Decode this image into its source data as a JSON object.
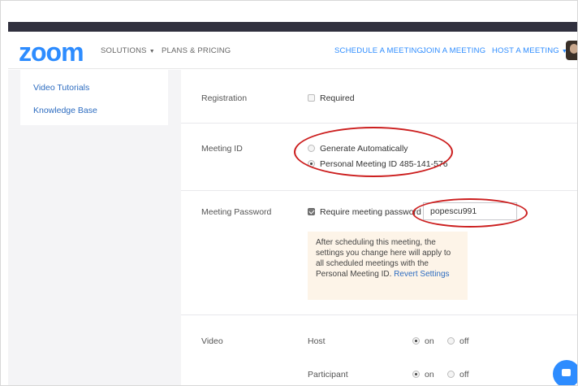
{
  "brand": {
    "logo": "zoom",
    "accent": "#2d8cff"
  },
  "nav": {
    "solutions": "SOLUTIONS",
    "plans": "PLANS & PRICING",
    "schedule": "SCHEDULE A MEETING",
    "join": "JOIN A MEETING",
    "host": "HOST A MEETING"
  },
  "sidebar": {
    "items": [
      {
        "label": "Video Tutorials"
      },
      {
        "label": "Knowledge Base"
      }
    ]
  },
  "form": {
    "registration": {
      "label": "Registration",
      "option": "Required",
      "checked": false
    },
    "meeting_id": {
      "label": "Meeting ID",
      "options": [
        {
          "label": "Generate Automatically",
          "selected": false
        },
        {
          "label": "Personal Meeting ID 485-141-576",
          "selected": true
        }
      ]
    },
    "password": {
      "label": "Meeting Password",
      "checkbox_label": "Require meeting password",
      "checked": true,
      "value": "popescu991",
      "note": "After scheduling this meeting, the settings you change here will apply to all scheduled meetings with the Personal Meeting ID.",
      "note_link": "Revert Settings"
    },
    "video": {
      "label": "Video",
      "host_label": "Host",
      "participant_label": "Participant",
      "on": "on",
      "off": "off",
      "host_value": "on",
      "participant_value": "on"
    }
  },
  "annotation_color": "#cc1f1f"
}
